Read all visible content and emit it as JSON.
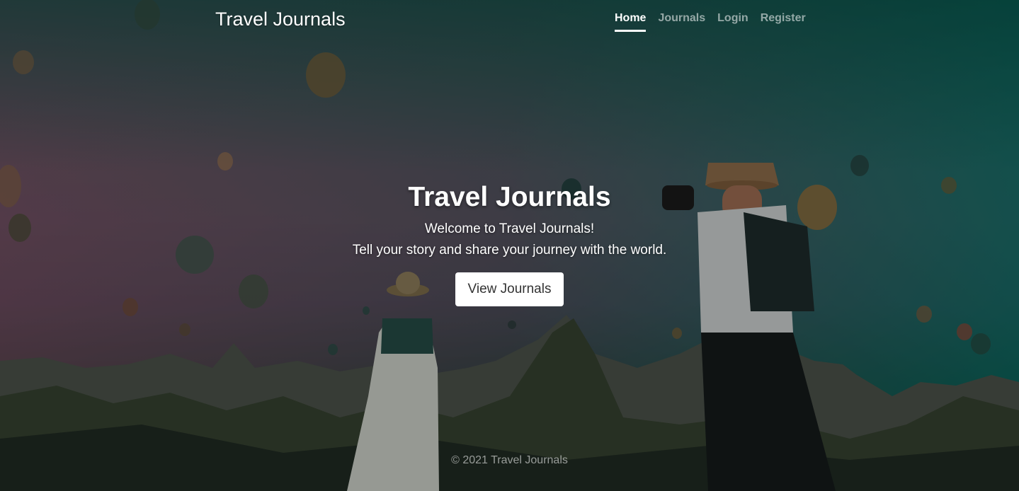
{
  "header": {
    "brand": "Travel Journals",
    "nav": [
      {
        "label": "Home",
        "active": true
      },
      {
        "label": "Journals",
        "active": false
      },
      {
        "label": "Login",
        "active": false
      },
      {
        "label": "Register",
        "active": false
      }
    ]
  },
  "hero": {
    "title": "Travel Journals",
    "lead_1": "Welcome to Travel Journals!",
    "lead_2": "Tell your story and share your journey with the world.",
    "button_label": "View Journals"
  },
  "footer": {
    "text": "© 2021 Travel Journals"
  },
  "colors": {
    "overlay_teal": "#006e64",
    "overlay_mauve": "#6e465a",
    "button_bg": "#ffffff"
  }
}
